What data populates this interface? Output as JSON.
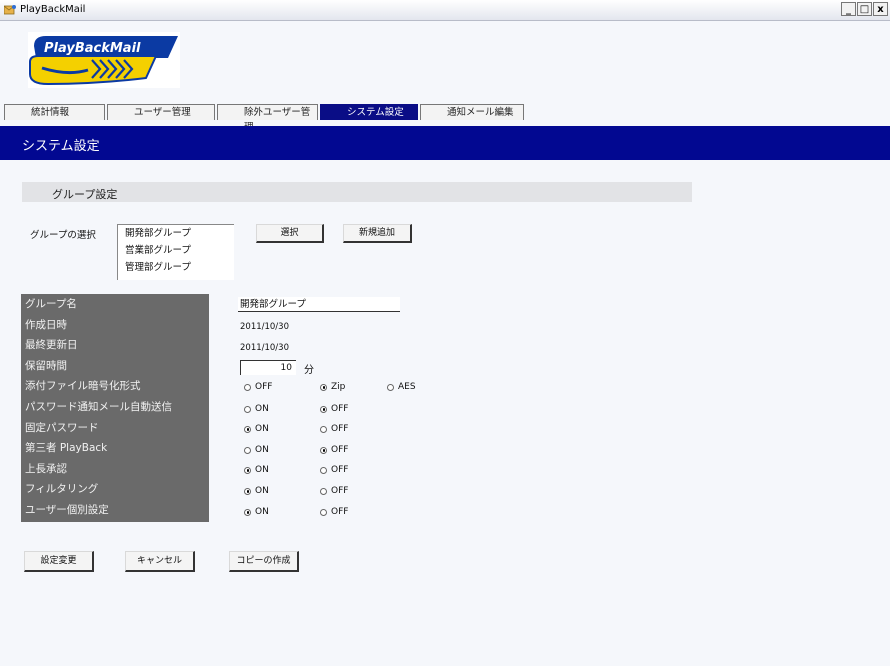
{
  "window": {
    "title": "PlayBackMail",
    "controls": [
      "_",
      "□",
      "x"
    ]
  },
  "logo": {
    "text": "PlayBackMail"
  },
  "tabs": [
    {
      "label": "統計情報",
      "active": false
    },
    {
      "label": "ユーザー管理",
      "active": false
    },
    {
      "label": "除外ユーザー管理",
      "active": false
    },
    {
      "label": "システム設定",
      "active": true
    },
    {
      "label": "通知メール編集",
      "active": false
    }
  ],
  "section": {
    "title": "システム設定"
  },
  "group_settings": {
    "header": "グループ設定",
    "select_label": "グループの選択",
    "groups": [
      "開発部グループ",
      "営業部グループ",
      "管理部グループ"
    ],
    "select_button": "選択",
    "new_button": "新規追加"
  },
  "properties": {
    "labels": [
      "グループ名",
      "作成日時",
      "最終更新日",
      "保留時間",
      "添付ファイル暗号化形式",
      "パスワード通知メール自動送信",
      "固定パスワード",
      "第三者 PlayBack",
      "上長承認",
      "フィルタリング",
      "ユーザー個別設定"
    ],
    "group_name": "開発部グループ",
    "created": "2011/10/30",
    "updated": "2011/10/30",
    "retention_value": "10",
    "retention_unit": "分",
    "encryption": {
      "options": [
        "OFF",
        "Zip",
        "AES"
      ],
      "selected": "Zip"
    },
    "password_mail": {
      "options": [
        "ON",
        "OFF"
      ],
      "selected": "OFF"
    },
    "fixed_password": {
      "options": [
        "ON",
        "OFF"
      ],
      "selected": "ON"
    },
    "third_party": {
      "options": [
        "ON",
        "OFF"
      ],
      "selected": "OFF"
    },
    "approval": {
      "options": [
        "ON",
        "OFF"
      ],
      "selected": "ON"
    },
    "filtering": {
      "options": [
        "ON",
        "OFF"
      ],
      "selected": "ON"
    },
    "user_individual": {
      "options": [
        "ON",
        "OFF"
      ],
      "selected": "ON"
    }
  },
  "actions": {
    "apply": "設定変更",
    "cancel": "キャンセル",
    "copy": "コピーの作成"
  },
  "colors": {
    "section_bar": "#020891",
    "tab_active": "#0a0d86",
    "panel": "#6a6a6a",
    "logo_blue": "#0b3aa3",
    "logo_yellow": "#f4d000"
  }
}
